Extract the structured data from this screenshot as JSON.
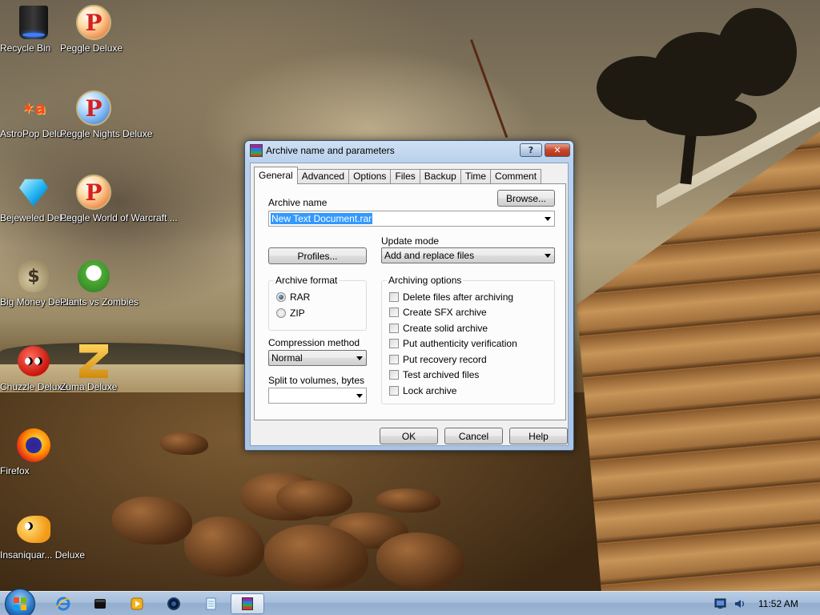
{
  "desktop": {
    "icons": [
      {
        "label": "Recycle Bin",
        "icon": "recycle-bin-icon"
      },
      {
        "label": "Peggle Deluxe",
        "icon": "peggle-icon"
      },
      {
        "label": "AstroPop Deluxe",
        "icon": "astropop-icon"
      },
      {
        "label": "Peggle Nights Deluxe",
        "icon": "peggle-nights-icon"
      },
      {
        "label": "Bejeweled Deluxe",
        "icon": "bejeweled-gem-icon"
      },
      {
        "label": "Peggle World of Warcraft ...",
        "icon": "peggle-wow-icon"
      },
      {
        "label": "Big Money Deluxe",
        "icon": "money-bag-icon"
      },
      {
        "label": "Plants vs Zombies",
        "icon": "plants-vs-zombies-icon"
      },
      {
        "label": "Chuzzle Deluxe",
        "icon": "chuzzle-icon"
      },
      {
        "label": "Zuma Deluxe",
        "icon": "zuma-icon"
      },
      {
        "label": "Firefox",
        "icon": "firefox-icon"
      },
      {
        "label": "Insaniquar... Deluxe",
        "icon": "insaniquarium-fish-icon"
      }
    ]
  },
  "dialog": {
    "title": "Archive name and parameters",
    "help_glyph": "?",
    "close_glyph": "✕",
    "tabs": [
      "General",
      "Advanced",
      "Options",
      "Files",
      "Backup",
      "Time",
      "Comment"
    ],
    "active_tab": "General",
    "archive_name_label": "Archive name",
    "browse_label": "Browse...",
    "archive_name_value": "New Text Document.rar",
    "profiles_label": "Profiles...",
    "update_mode_label": "Update mode",
    "update_mode_value": "Add and replace files",
    "archive_format": {
      "title": "Archive format",
      "options": [
        "RAR",
        "ZIP"
      ],
      "selected": "RAR"
    },
    "compression_method_label": "Compression method",
    "compression_method_value": "Normal",
    "split_label": "Split to volumes, bytes",
    "split_value": "",
    "archiving_options": {
      "title": "Archiving options",
      "items": [
        {
          "label": "Delete files after archiving",
          "checked": false
        },
        {
          "label": "Create SFX archive",
          "checked": false
        },
        {
          "label": "Create solid archive",
          "checked": false
        },
        {
          "label": "Put authenticity verification",
          "checked": false
        },
        {
          "label": "Put recovery record",
          "checked": false
        },
        {
          "label": "Test archived files",
          "checked": false
        },
        {
          "label": "Lock archive",
          "checked": false
        }
      ]
    },
    "ok_label": "OK",
    "cancel_label": "Cancel",
    "help_label": "Help"
  },
  "taskbar": {
    "items": [
      "internet-explorer-icon",
      "terminal-icon",
      "media-player-icon",
      "circle-app-icon",
      "notepad-icon",
      "winrar-icon"
    ],
    "active_item": "winrar-icon",
    "clock": "11:52 AM",
    "tray_icons": [
      "network-icon",
      "volume-icon"
    ]
  },
  "colors": {
    "dialog_frame": "#a9c4e4",
    "selection": "#3399ff",
    "close_button": "#c8452a",
    "taskbar": "#a7bedb"
  }
}
